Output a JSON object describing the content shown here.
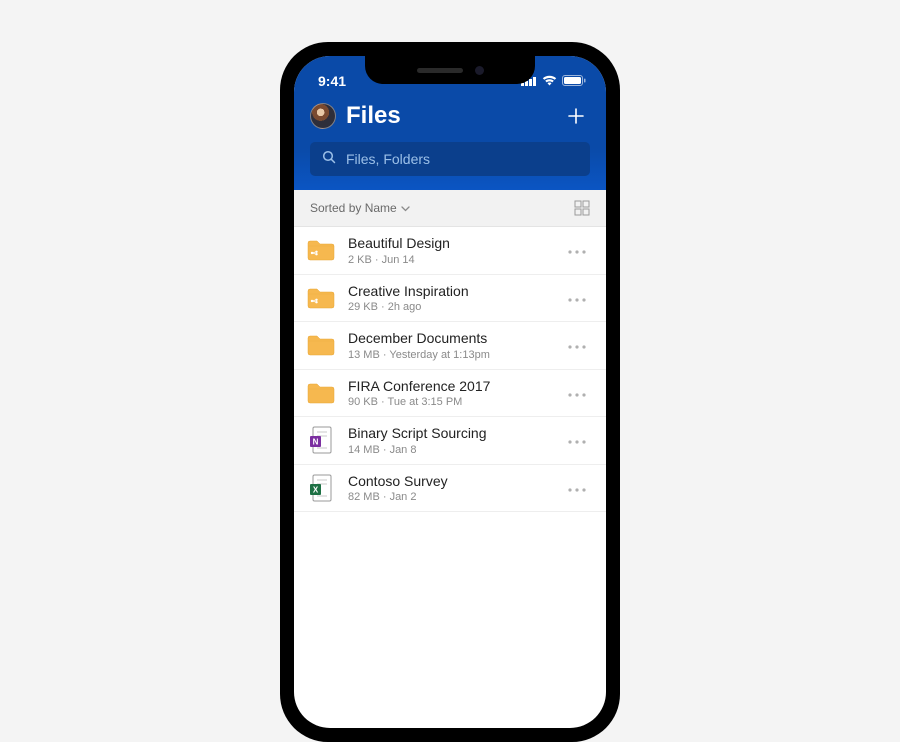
{
  "status": {
    "time": "9:41"
  },
  "header": {
    "title": "Files",
    "add_label": "+"
  },
  "search": {
    "placeholder": "Files, Folders"
  },
  "sort": {
    "label": "Sorted by Name"
  },
  "items": [
    {
      "type": "folder-shared",
      "name": "Beautiful Design",
      "meta": "2 KB · Jun 14"
    },
    {
      "type": "folder-shared",
      "name": "Creative Inspiration",
      "meta": "29 KB · 2h ago"
    },
    {
      "type": "folder",
      "name": "December Documents",
      "meta": "13 MB · Yesterday at 1:13pm"
    },
    {
      "type": "folder",
      "name": "FIRA Conference 2017",
      "meta": "90 KB · Tue at 3:15 PM"
    },
    {
      "type": "onenote",
      "name": "Binary Script Sourcing",
      "meta": "14 MB · Jan 8"
    },
    {
      "type": "excel",
      "name": "Contoso Survey",
      "meta": "82 MB · Jan 2"
    }
  ],
  "icons": {
    "folder_fill": "#f6b84f",
    "folder_stroke": "#e8a637",
    "onenote_accent": "#7b2fa0",
    "excel_accent": "#1d7044"
  }
}
